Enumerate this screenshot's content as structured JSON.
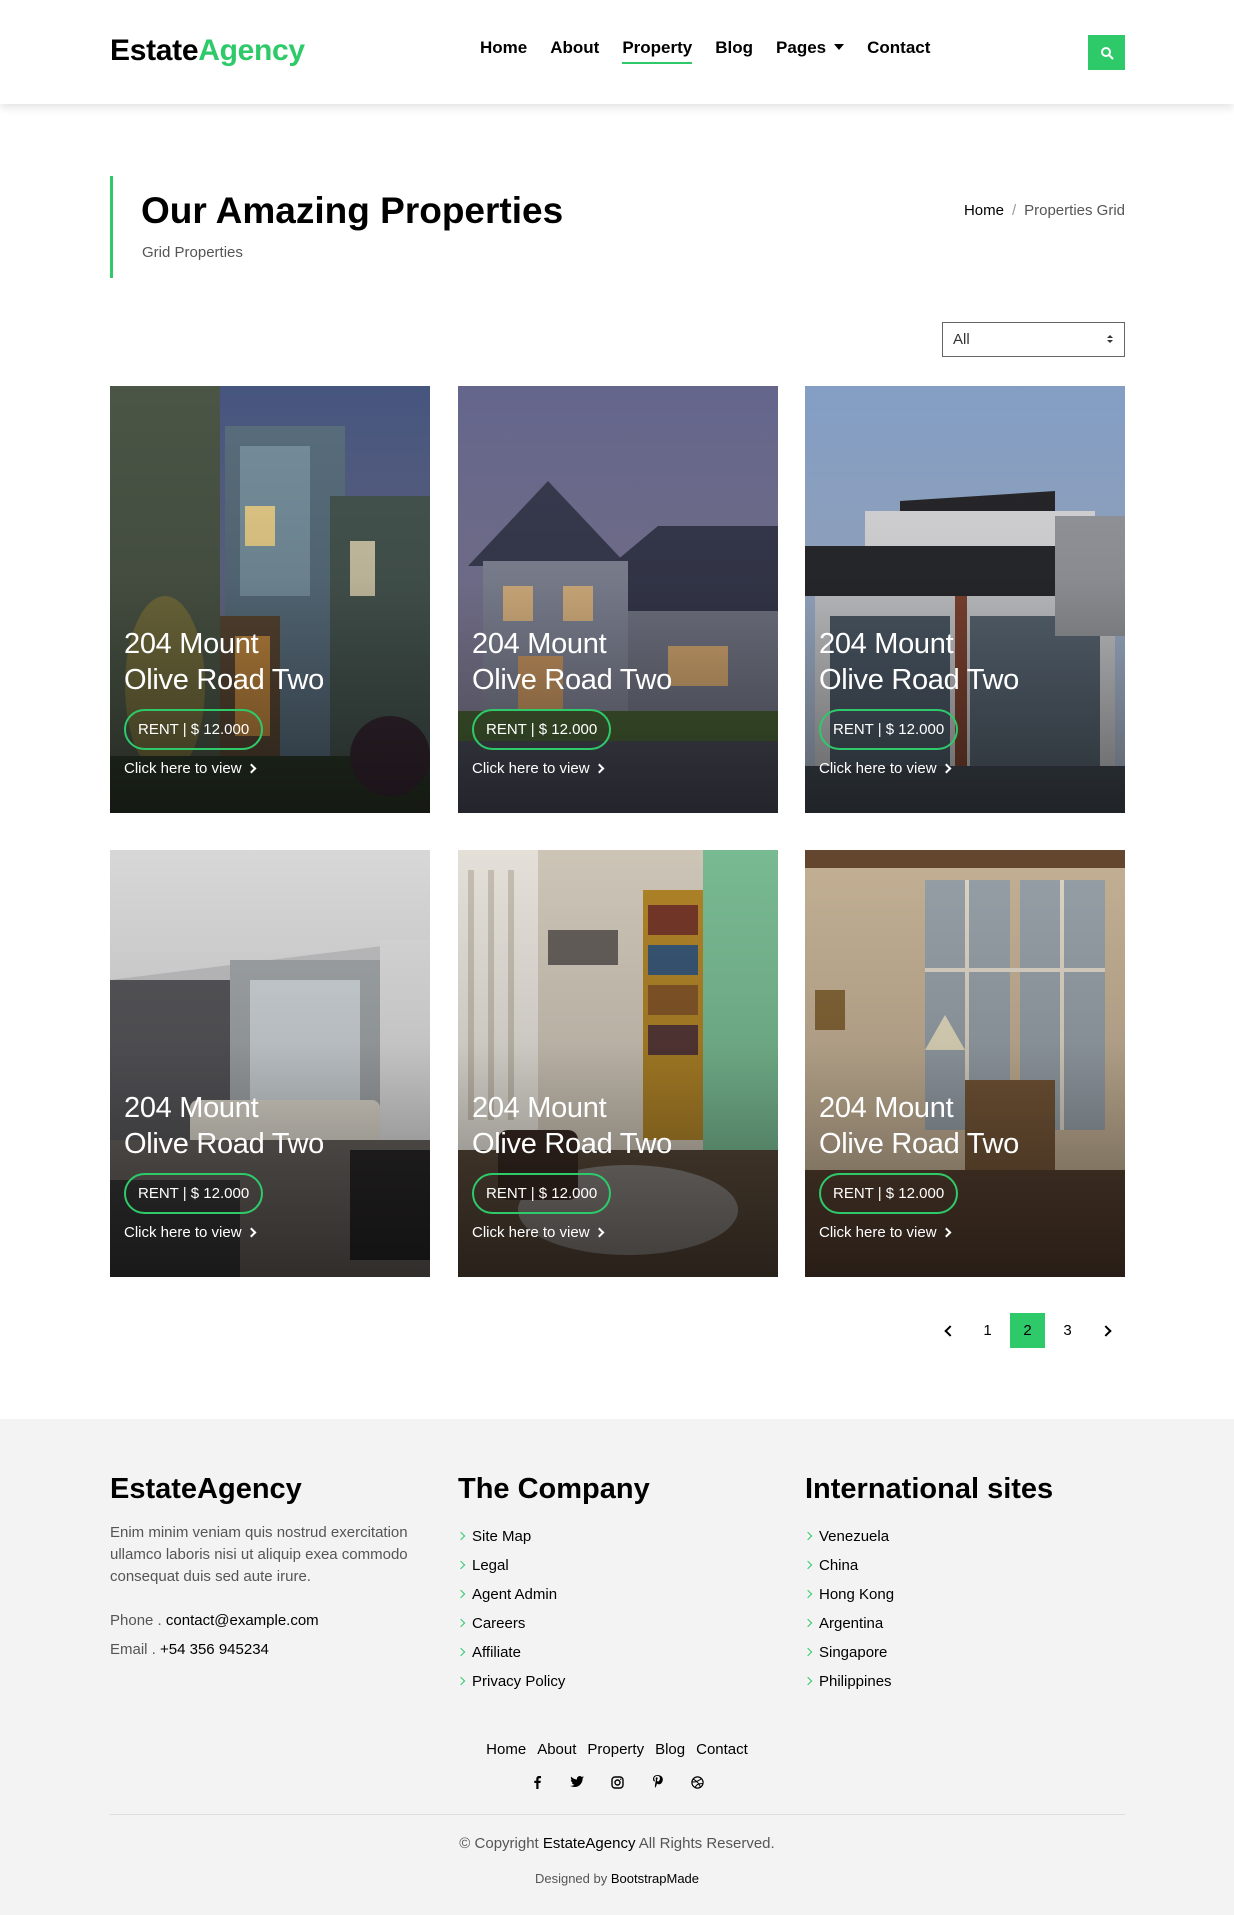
{
  "brand": {
    "part1": "Estate",
    "part2": "Agency"
  },
  "nav": {
    "home": "Home",
    "about": "About",
    "property": "Property",
    "blog": "Blog",
    "pages": "Pages",
    "contact": "Contact"
  },
  "intro": {
    "title": "Our Amazing Properties",
    "subtitle": "Grid Properties",
    "breadcrumb_home": "Home",
    "breadcrumb_sep": "/",
    "breadcrumb_current": "Properties Grid"
  },
  "filter": {
    "selected": "All"
  },
  "cards": [
    {
      "title_line1": "204 Mount",
      "title_line2": "Olive Road Two",
      "price": "RENT | $ 12.000",
      "link": "Click here to view"
    },
    {
      "title_line1": "204 Mount",
      "title_line2": "Olive Road Two",
      "price": "RENT | $ 12.000",
      "link": "Click here to view"
    },
    {
      "title_line1": "204 Mount",
      "title_line2": "Olive Road Two",
      "price": "RENT | $ 12.000",
      "link": "Click here to view"
    },
    {
      "title_line1": "204 Mount",
      "title_line2": "Olive Road Two",
      "price": "RENT | $ 12.000",
      "link": "Click here to view"
    },
    {
      "title_line1": "204 Mount",
      "title_line2": "Olive Road Two",
      "price": "RENT | $ 12.000",
      "link": "Click here to view"
    },
    {
      "title_line1": "204 Mount",
      "title_line2": "Olive Road Two",
      "price": "RENT | $ 12.000",
      "link": "Click here to view"
    }
  ],
  "pagination": {
    "pages": [
      "1",
      "2",
      "3"
    ],
    "current": "2"
  },
  "footer": {
    "about": {
      "title": "EstateAgency",
      "description": "Enim minim veniam quis nostrud exercitation ullamco laboris nisi ut aliquip exea commodo consequat duis sed aute irure.",
      "phone_label": "Phone .",
      "phone_value": "contact@example.com",
      "email_label": "Email .",
      "email_value": "+54 356 945234"
    },
    "company": {
      "title": "The Company",
      "links": [
        "Site Map",
        "Legal",
        "Agent Admin",
        "Careers",
        "Affiliate",
        "Privacy Policy"
      ]
    },
    "international": {
      "title": "International sites",
      "links": [
        "Venezuela",
        "China",
        "Hong Kong",
        "Argentina",
        "Singapore",
        "Philippines"
      ]
    },
    "nav": [
      "Home",
      "About",
      "Property",
      "Blog",
      "Contact"
    ],
    "social_icons": [
      "facebook-icon",
      "twitter-icon",
      "instagram-icon",
      "pinterest-icon",
      "dribbble-icon"
    ],
    "copyright_prefix": "© Copyright",
    "copyright_brand": "EstateAgency",
    "copyright_suffix": "All Rights Reserved.",
    "designed_prefix": "Designed by",
    "designed_brand": "BootstrapMade"
  },
  "colors": {
    "accent": "#2eca6a",
    "footer_bg": "#f3f3f3"
  }
}
